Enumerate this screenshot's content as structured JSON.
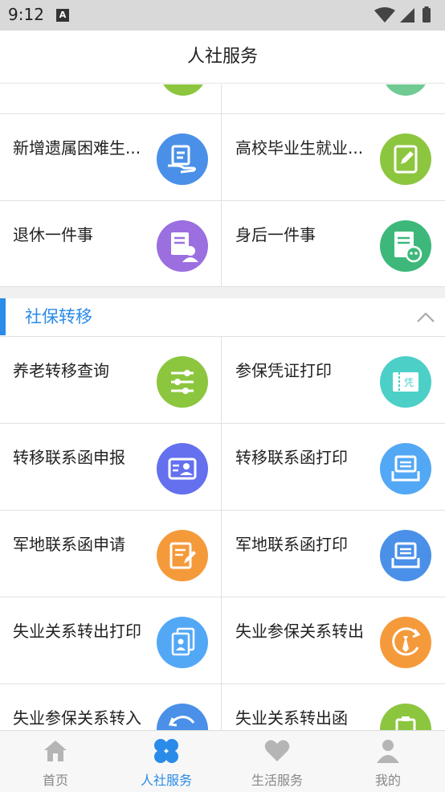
{
  "status_bar": {
    "time": "9:12",
    "notification_letter": "A"
  },
  "header": {
    "title": "人社服务"
  },
  "section_transfer": {
    "title": "社保转移"
  },
  "top_rows": [
    {
      "left": "新增遗属困难生...",
      "right": "高校毕业生就业..."
    },
    {
      "left": "退休一件事",
      "right": "身后一件事"
    }
  ],
  "transfer_rows": [
    {
      "left": "养老转移查询",
      "right": "参保凭证打印"
    },
    {
      "left": "转移联系函申报",
      "right": "转移联系函打印"
    },
    {
      "left": "军地联系函申请",
      "right": "军地联系函打印"
    },
    {
      "left": "失业关系转出打印",
      "right": "失业参保关系转出"
    },
    {
      "left": "失业参保关系转入",
      "right": "失业关系转出函"
    }
  ],
  "icon_badge_text": "凭",
  "bottom_nav": [
    {
      "label": "首页",
      "icon": "home-icon"
    },
    {
      "label": "人社服务",
      "icon": "clover-icon"
    },
    {
      "label": "生活服务",
      "icon": "heart-icon"
    },
    {
      "label": "我的",
      "icon": "person-icon"
    }
  ],
  "colors": {
    "accent": "#2a8be8",
    "icon_blue": "#4a90e8",
    "icon_green": "#8cc63f",
    "icon_purple": "#9b6fe0",
    "icon_teal_green": "#3db87a",
    "icon_teal": "#4ccfc7",
    "icon_indigo": "#6470ee",
    "icon_sky": "#53a8f5",
    "icon_orange": "#f59a3b"
  }
}
